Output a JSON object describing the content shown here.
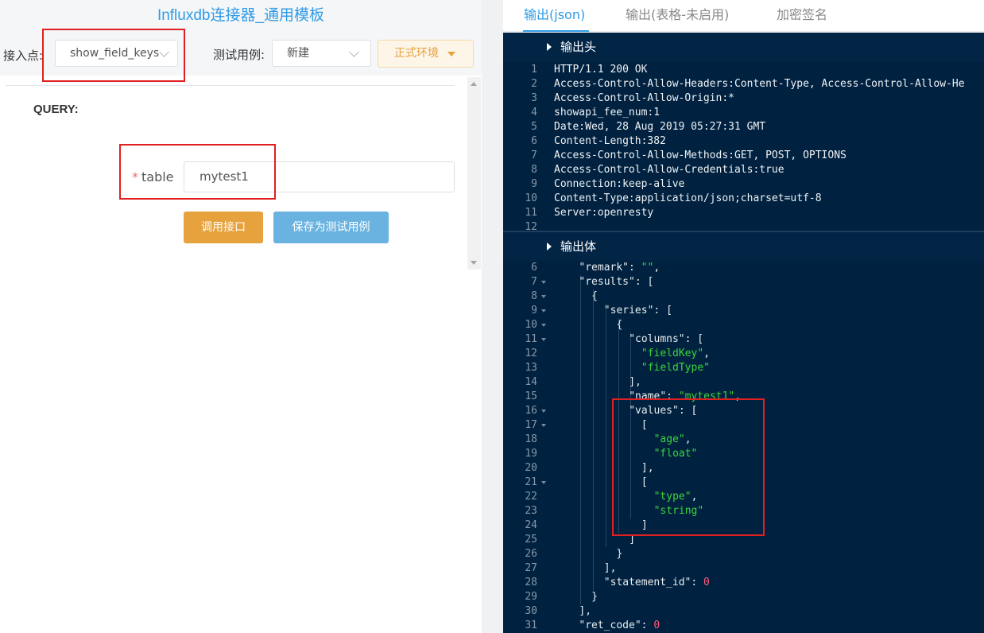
{
  "left": {
    "title": "Influxdb连接器_通用模板",
    "endpoint_label": "接入点:",
    "endpoint_value": "show_field_keys",
    "testcase_label": "测试用例:",
    "testcase_value": "新建",
    "env_button": "正式环境",
    "query_label": "QUERY:",
    "table_required_mark": "*",
    "table_label": "table",
    "table_value": "mytest1",
    "call_button": "调用接口",
    "save_button": "保存为测试用例"
  },
  "right": {
    "tabs": [
      "输出(json)",
      "输出(表格-未启用)",
      "加密签名"
    ],
    "active_tab": 0,
    "header_section_title": "输出头",
    "body_section_title": "输出体",
    "header_lines": [
      {
        "n": "1",
        "text": "HTTP/1.1 200 OK"
      },
      {
        "n": "2",
        "text": "Access-Control-Allow-Headers:Content-Type, Access-Control-Allow-He"
      },
      {
        "n": "3",
        "text": "Access-Control-Allow-Origin:*"
      },
      {
        "n": "4",
        "text": "showapi_fee_num:1"
      },
      {
        "n": "5",
        "text": "Date:Wed, 28 Aug 2019 05:27:31 GMT"
      },
      {
        "n": "6",
        "text": "Content-Length:382"
      },
      {
        "n": "7",
        "text": "Access-Control-Allow-Methods:GET, POST, OPTIONS"
      },
      {
        "n": "8",
        "text": "Access-Control-Allow-Credentials:true"
      },
      {
        "n": "9",
        "text": "Connection:keep-alive"
      },
      {
        "n": "10",
        "text": "Content-Type:application/json;charset=utf-8"
      },
      {
        "n": "11",
        "text": "Server:openresty"
      },
      {
        "n": "12",
        "text": ""
      }
    ],
    "body_lines": [
      {
        "n": "6",
        "fold": false,
        "indent": 2,
        "tokens": [
          [
            "k",
            "\"remark\""
          ],
          [
            "p",
            ": "
          ],
          [
            "s",
            "\"\""
          ],
          [
            "p",
            ","
          ]
        ]
      },
      {
        "n": "7",
        "fold": true,
        "indent": 2,
        "tokens": [
          [
            "k",
            "\"results\""
          ],
          [
            "p",
            ": ["
          ]
        ]
      },
      {
        "n": "8",
        "fold": true,
        "indent": 3,
        "tokens": [
          [
            "p",
            "{"
          ]
        ]
      },
      {
        "n": "9",
        "fold": true,
        "indent": 4,
        "tokens": [
          [
            "k",
            "\"series\""
          ],
          [
            "p",
            ": ["
          ]
        ]
      },
      {
        "n": "10",
        "fold": true,
        "indent": 5,
        "tokens": [
          [
            "p",
            "{"
          ]
        ]
      },
      {
        "n": "11",
        "fold": true,
        "indent": 6,
        "tokens": [
          [
            "k",
            "\"columns\""
          ],
          [
            "p",
            ": ["
          ]
        ]
      },
      {
        "n": "12",
        "fold": false,
        "indent": 7,
        "tokens": [
          [
            "s",
            "\"fieldKey\""
          ],
          [
            "p",
            ","
          ]
        ]
      },
      {
        "n": "13",
        "fold": false,
        "indent": 7,
        "tokens": [
          [
            "s",
            "\"fieldType\""
          ]
        ]
      },
      {
        "n": "14",
        "fold": false,
        "indent": 6,
        "tokens": [
          [
            "p",
            "],"
          ]
        ]
      },
      {
        "n": "15",
        "fold": false,
        "indent": 6,
        "tokens": [
          [
            "k",
            "\"name\""
          ],
          [
            "p",
            ": "
          ],
          [
            "s",
            "\"mytest1\""
          ],
          [
            "p",
            ","
          ]
        ]
      },
      {
        "n": "16",
        "fold": true,
        "indent": 6,
        "tokens": [
          [
            "k",
            "\"values\""
          ],
          [
            "p",
            ": ["
          ]
        ]
      },
      {
        "n": "17",
        "fold": true,
        "indent": 7,
        "tokens": [
          [
            "p",
            "["
          ]
        ]
      },
      {
        "n": "18",
        "fold": false,
        "indent": 8,
        "tokens": [
          [
            "s",
            "\"age\""
          ],
          [
            "p",
            ","
          ]
        ]
      },
      {
        "n": "19",
        "fold": false,
        "indent": 8,
        "tokens": [
          [
            "s",
            "\"float\""
          ]
        ]
      },
      {
        "n": "20",
        "fold": false,
        "indent": 7,
        "tokens": [
          [
            "p",
            "],"
          ]
        ]
      },
      {
        "n": "21",
        "fold": true,
        "indent": 7,
        "tokens": [
          [
            "p",
            "["
          ]
        ]
      },
      {
        "n": "22",
        "fold": false,
        "indent": 8,
        "tokens": [
          [
            "s",
            "\"type\""
          ],
          [
            "p",
            ","
          ]
        ]
      },
      {
        "n": "23",
        "fold": false,
        "indent": 8,
        "tokens": [
          [
            "s",
            "\"string\""
          ]
        ]
      },
      {
        "n": "24",
        "fold": false,
        "indent": 7,
        "tokens": [
          [
            "p",
            "]"
          ]
        ]
      },
      {
        "n": "25",
        "fold": false,
        "indent": 6,
        "tokens": [
          [
            "p",
            "]"
          ]
        ]
      },
      {
        "n": "26",
        "fold": false,
        "indent": 5,
        "tokens": [
          [
            "p",
            "}"
          ]
        ]
      },
      {
        "n": "27",
        "fold": false,
        "indent": 4,
        "tokens": [
          [
            "p",
            "],"
          ]
        ]
      },
      {
        "n": "28",
        "fold": false,
        "indent": 4,
        "tokens": [
          [
            "k",
            "\"statement_id\""
          ],
          [
            "p",
            ": "
          ],
          [
            "n",
            "0"
          ]
        ]
      },
      {
        "n": "29",
        "fold": false,
        "indent": 3,
        "tokens": [
          [
            "p",
            "}"
          ]
        ]
      },
      {
        "n": "30",
        "fold": false,
        "indent": 2,
        "tokens": [
          [
            "p",
            "],"
          ]
        ]
      },
      {
        "n": "31",
        "fold": false,
        "indent": 2,
        "tokens": [
          [
            "k",
            "\"ret_code\""
          ],
          [
            "p",
            ": "
          ],
          [
            "n",
            "0"
          ]
        ]
      }
    ]
  },
  "colors": {
    "brand_blue": "#2f9be5",
    "warning_orange": "#e6a23c",
    "code_bg": "#002240",
    "json_string": "#3bd63b",
    "json_number": "#ff5a7a",
    "highlight_red": "#e02020"
  }
}
